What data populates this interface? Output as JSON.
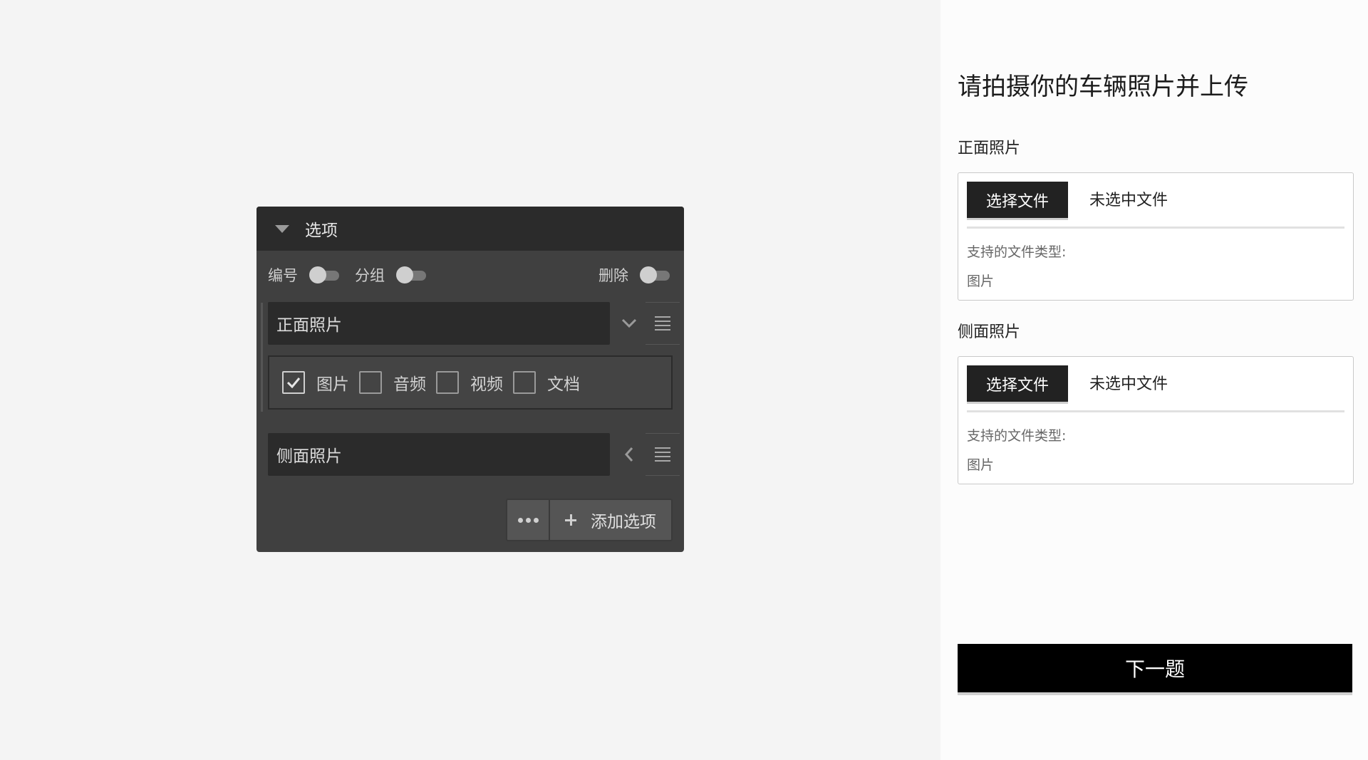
{
  "panel": {
    "title": "选项",
    "toggles": {
      "numbering": "编号",
      "grouping": "分组",
      "delete": "删除"
    },
    "options": [
      {
        "label": "正面照片",
        "expanded": true
      },
      {
        "label": "侧面照片",
        "expanded": false
      }
    ],
    "file_types": [
      {
        "label": "图片",
        "checked": true
      },
      {
        "label": "音频",
        "checked": false
      },
      {
        "label": "视频",
        "checked": false
      },
      {
        "label": "文档",
        "checked": false
      }
    ],
    "add_option_label": "添加选项"
  },
  "preview": {
    "question_title": "请拍摄你的车辆照片并上传",
    "fields": [
      {
        "label": "正面照片",
        "choose_label": "选择文件",
        "no_file_label": "未选中文件",
        "types_hint": "支持的文件类型:",
        "types_value": "图片"
      },
      {
        "label": "侧面照片",
        "choose_label": "选择文件",
        "no_file_label": "未选中文件",
        "types_hint": "支持的文件类型:",
        "types_value": "图片"
      }
    ],
    "next_label": "下一题"
  }
}
